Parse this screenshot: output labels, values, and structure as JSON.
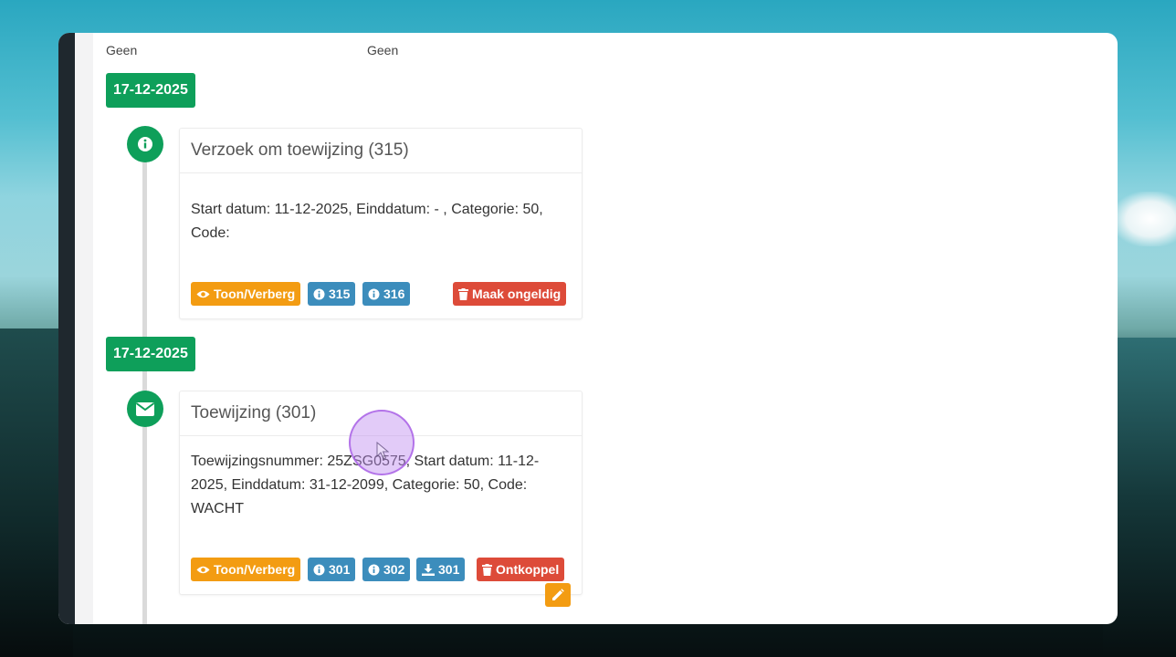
{
  "top_row": {
    "col1": "Geen",
    "col2": "Geen"
  },
  "entries": [
    {
      "date": "17-12-2025",
      "icon": "info-icon",
      "title": "Verzoek om toewijzing (315)",
      "body": "Start datum: 11-12-2025, Einddatum: - , Categorie: 50, Code:",
      "buttons": {
        "toggle": "Toon/Verberg",
        "ref1": "315",
        "ref2": "316",
        "action": "Maak ongeldig"
      }
    },
    {
      "date": "17-12-2025",
      "icon": "envelope-icon",
      "title": "Toewijzing (301)",
      "body": "Toewijzingsnummer: 25ZSG0575, Start datum: 11-12-2025, Einddatum: 31-12-2099, Categorie: 50, Code: WACHT",
      "buttons": {
        "toggle": "Toon/Verberg",
        "ref1": "301",
        "ref2": "302",
        "download": "301",
        "action": "Ontkoppel"
      }
    }
  ],
  "colors": {
    "green": "#0e9f5a",
    "orange": "#f39c12",
    "blue": "#3c8dbc",
    "red": "#dd4b39"
  }
}
